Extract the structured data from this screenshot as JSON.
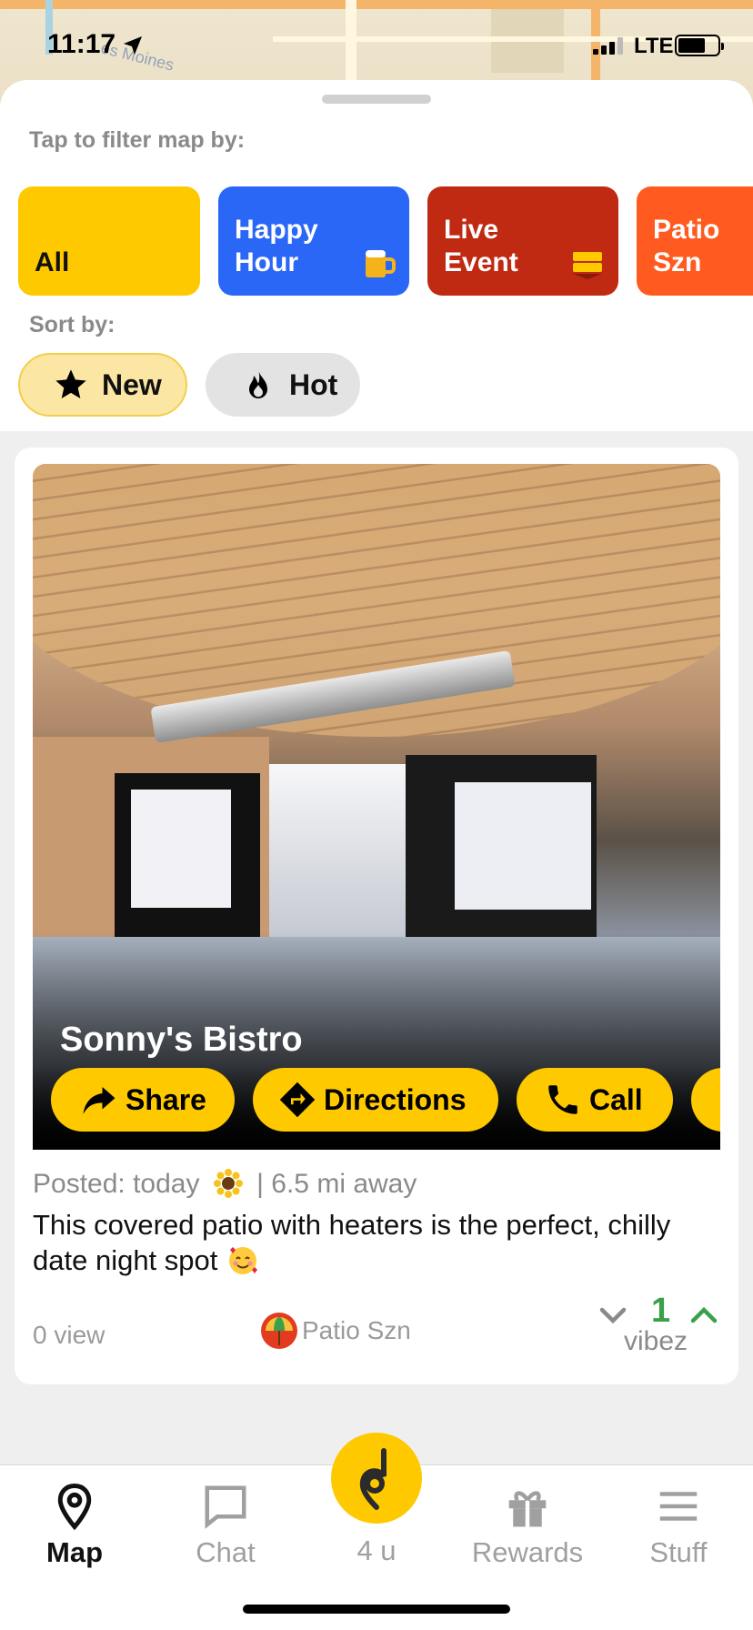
{
  "status": {
    "time": "11:17",
    "network": "LTE"
  },
  "map": {
    "label": "es Moines"
  },
  "filters": {
    "heading": "Tap to filter map by:",
    "items": [
      {
        "label_line1": "",
        "label_line2": "All",
        "color": "#ffc900",
        "icon": ""
      },
      {
        "label_line1": "Happy",
        "label_line2": "Hour",
        "color": "#2b67f6",
        "icon": "beer-mug-icon"
      },
      {
        "label_line1": "Live",
        "label_line2": "Event",
        "color": "#c02a12",
        "icon": "tickets-icon"
      },
      {
        "label_line1": "Patio",
        "label_line2": "Szn",
        "color": "#ff5a1f",
        "icon": ""
      }
    ]
  },
  "sort": {
    "heading": "Sort by:",
    "options": [
      {
        "label": "New",
        "icon": "star-icon",
        "selected": true
      },
      {
        "label": "Hot",
        "icon": "flame-icon",
        "selected": false
      }
    ]
  },
  "post": {
    "venue": "Sonny's Bistro",
    "actions": {
      "share": "Share",
      "directions": "Directions",
      "call": "Call"
    },
    "posted_prefix": "Posted: today",
    "posted_suffix": "| 6.5 mi away",
    "description": "This covered patio with heaters is the perfect, chilly date night spot",
    "views": "0 view",
    "tag": "Patio Szn",
    "vote_count": "1",
    "vote_label": "vibez"
  },
  "tabs": [
    {
      "label": "Map",
      "icon": "map-pin-icon",
      "active": true
    },
    {
      "label": "Chat",
      "icon": "chat-bubble-icon",
      "active": false
    },
    {
      "label": "4 u",
      "icon": "app-logo-icon",
      "active": false
    },
    {
      "label": "Rewards",
      "icon": "gift-icon",
      "active": false
    },
    {
      "label": "Stuff",
      "icon": "hamburger-menu-icon",
      "active": false
    }
  ],
  "colors": {
    "accent": "#ffc900",
    "vote_green": "#3aa14a",
    "happy_hour": "#2b67f6",
    "live_event": "#c02a12",
    "patio": "#ff5a1f"
  }
}
